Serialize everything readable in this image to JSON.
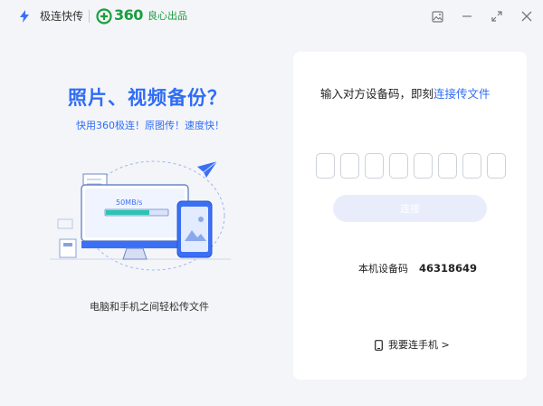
{
  "app": {
    "name": "极连快传",
    "brand_number": "360",
    "brand_tag": "良心出品",
    "accent_color": "#2f6cf6",
    "brand_color": "#1a9e3f"
  },
  "window_controls": {
    "icons": [
      "gallery-icon",
      "minimize-icon",
      "maximize-icon",
      "close-icon"
    ]
  },
  "left_panel": {
    "headline": "照片、视频备份？",
    "subline": "快用360极连！原图传！速度快！",
    "illustration_speed": "50MB/s",
    "caption": "电脑和手机之间轻松传文件"
  },
  "card": {
    "prompt_prefix": "输入对方设备码，即刻",
    "prompt_highlight": "连接传文件",
    "code_box_count": 8,
    "connect_button": "连接",
    "device_code_label": "本机设备码",
    "device_code_value": "46318649",
    "phone_link": "我要连手机 >"
  }
}
